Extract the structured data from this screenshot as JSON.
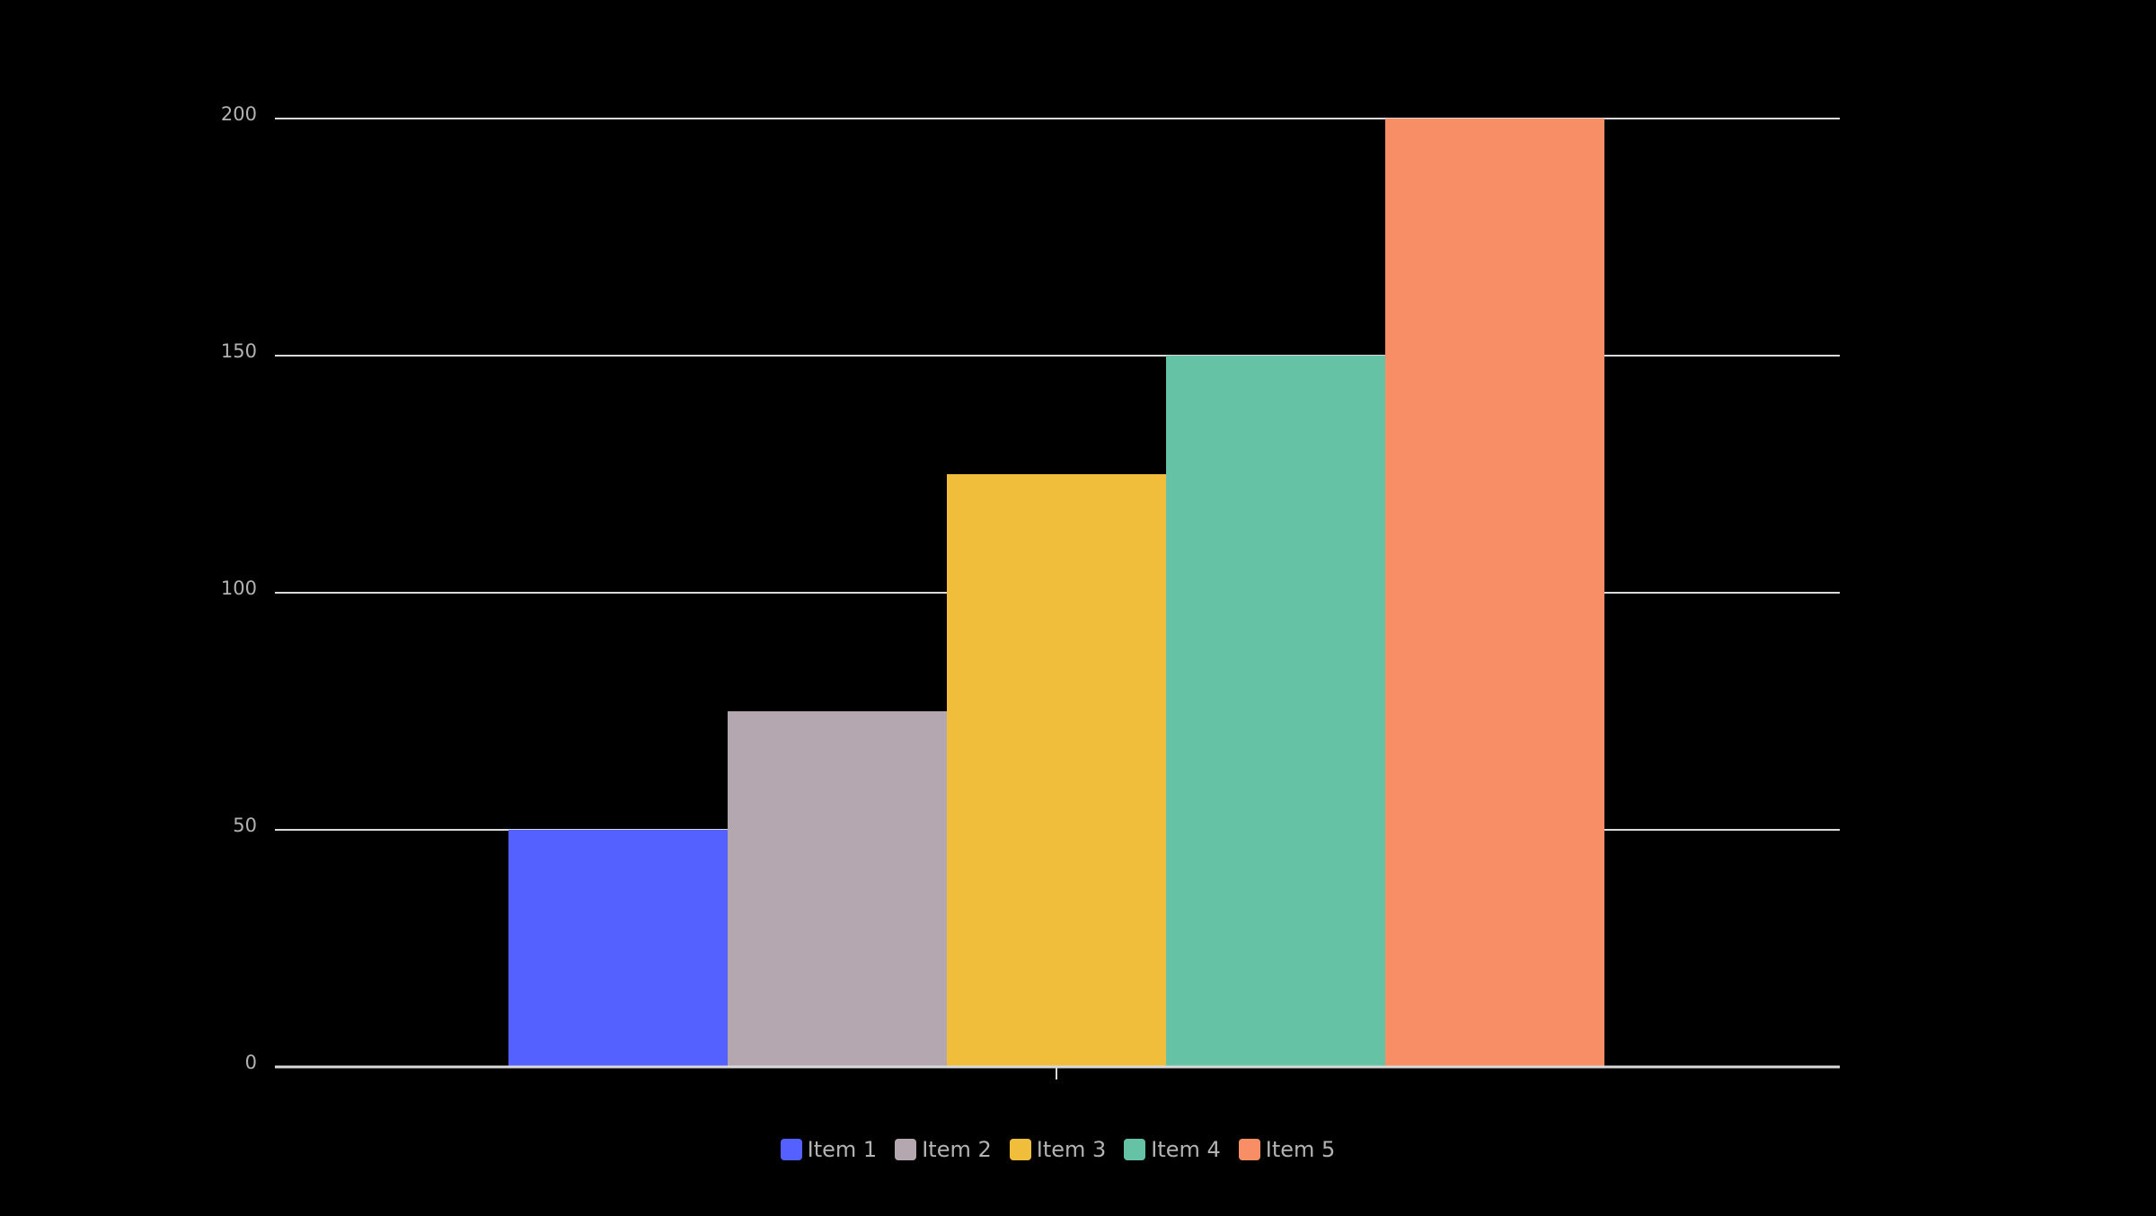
{
  "chart_data": {
    "type": "bar",
    "title": "",
    "xlabel": "",
    "ylabel": "",
    "categories": [
      ""
    ],
    "series": [
      {
        "name": "Item 1",
        "values": [
          50
        ],
        "color": "#5461FF"
      },
      {
        "name": "Item 2",
        "values": [
          75
        ],
        "color": "#B5A7B0"
      },
      {
        "name": "Item 3",
        "values": [
          125
        ],
        "color": "#F0BE3A"
      },
      {
        "name": "Item 4",
        "values": [
          150
        ],
        "color": "#65C2A5"
      },
      {
        "name": "Item 5",
        "values": [
          200
        ],
        "color": "#F88E65"
      }
    ],
    "ylim": [
      0,
      200
    ],
    "yticks": [
      0,
      50,
      100,
      150,
      200
    ],
    "ytick_labels": [
      "0",
      "50",
      "100",
      "150",
      "200"
    ],
    "grid": true,
    "legend_position": "bottom-center",
    "background": "#000000",
    "text_color": "#b3b3b3",
    "grid_color": "#d9d9d9"
  }
}
